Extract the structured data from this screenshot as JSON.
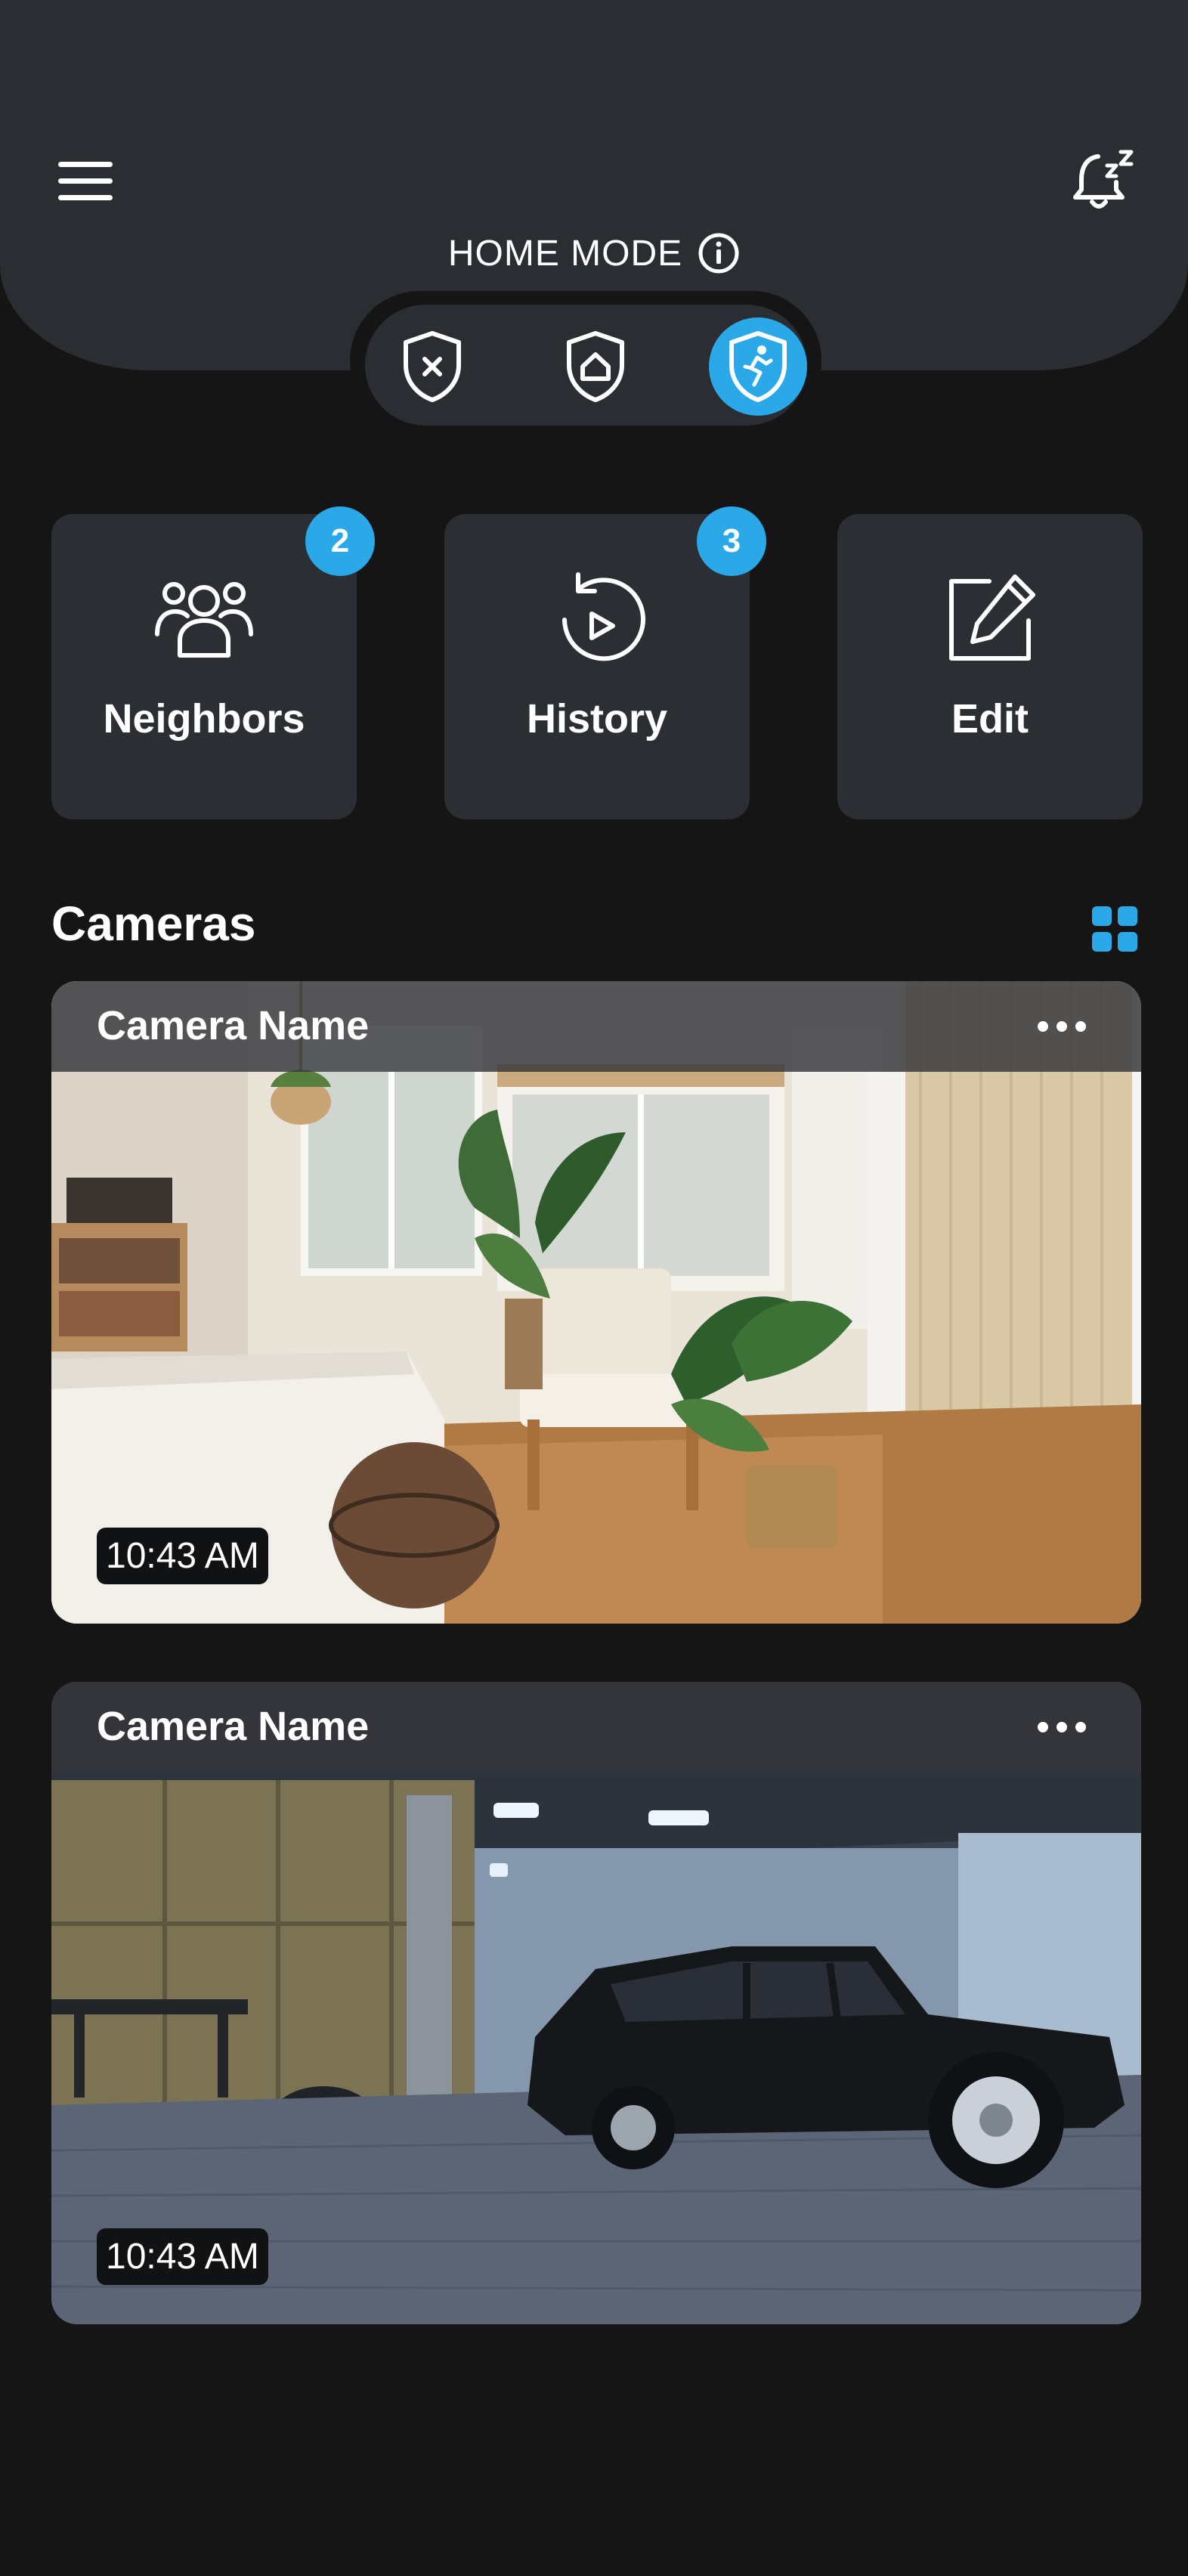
{
  "header": {
    "menu_icon": "hamburger-menu-icon",
    "bell_icon": "bell-snooze-icon",
    "mode_title": "HOME MODE",
    "info_icon": "info-circle-icon",
    "modes": [
      {
        "name": "disarmed",
        "icon": "shield-x-icon",
        "active": false
      },
      {
        "name": "home",
        "icon": "shield-home-icon",
        "active": false
      },
      {
        "name": "away",
        "icon": "shield-running-icon",
        "active": true
      }
    ],
    "accent_color": "#2aa8e8"
  },
  "tiles": [
    {
      "label": "Neighbors",
      "icon": "neighbors-icon",
      "badge": "2"
    },
    {
      "label": "History",
      "icon": "history-play-icon",
      "badge": "3"
    },
    {
      "label": "Edit",
      "icon": "edit-pencil-icon",
      "badge": null
    }
  ],
  "cameras_section": {
    "title": "Cameras",
    "view_icon": "grid-view-icon"
  },
  "cameras": [
    {
      "name": "Camera Name",
      "timestamp": "10:43 AM",
      "more_icon": "more-horizontal-icon",
      "scene": "living room"
    },
    {
      "name": "Camera Name",
      "timestamp": "10:43 AM",
      "more_icon": "more-horizontal-icon",
      "scene": "garage with vintage car"
    }
  ]
}
